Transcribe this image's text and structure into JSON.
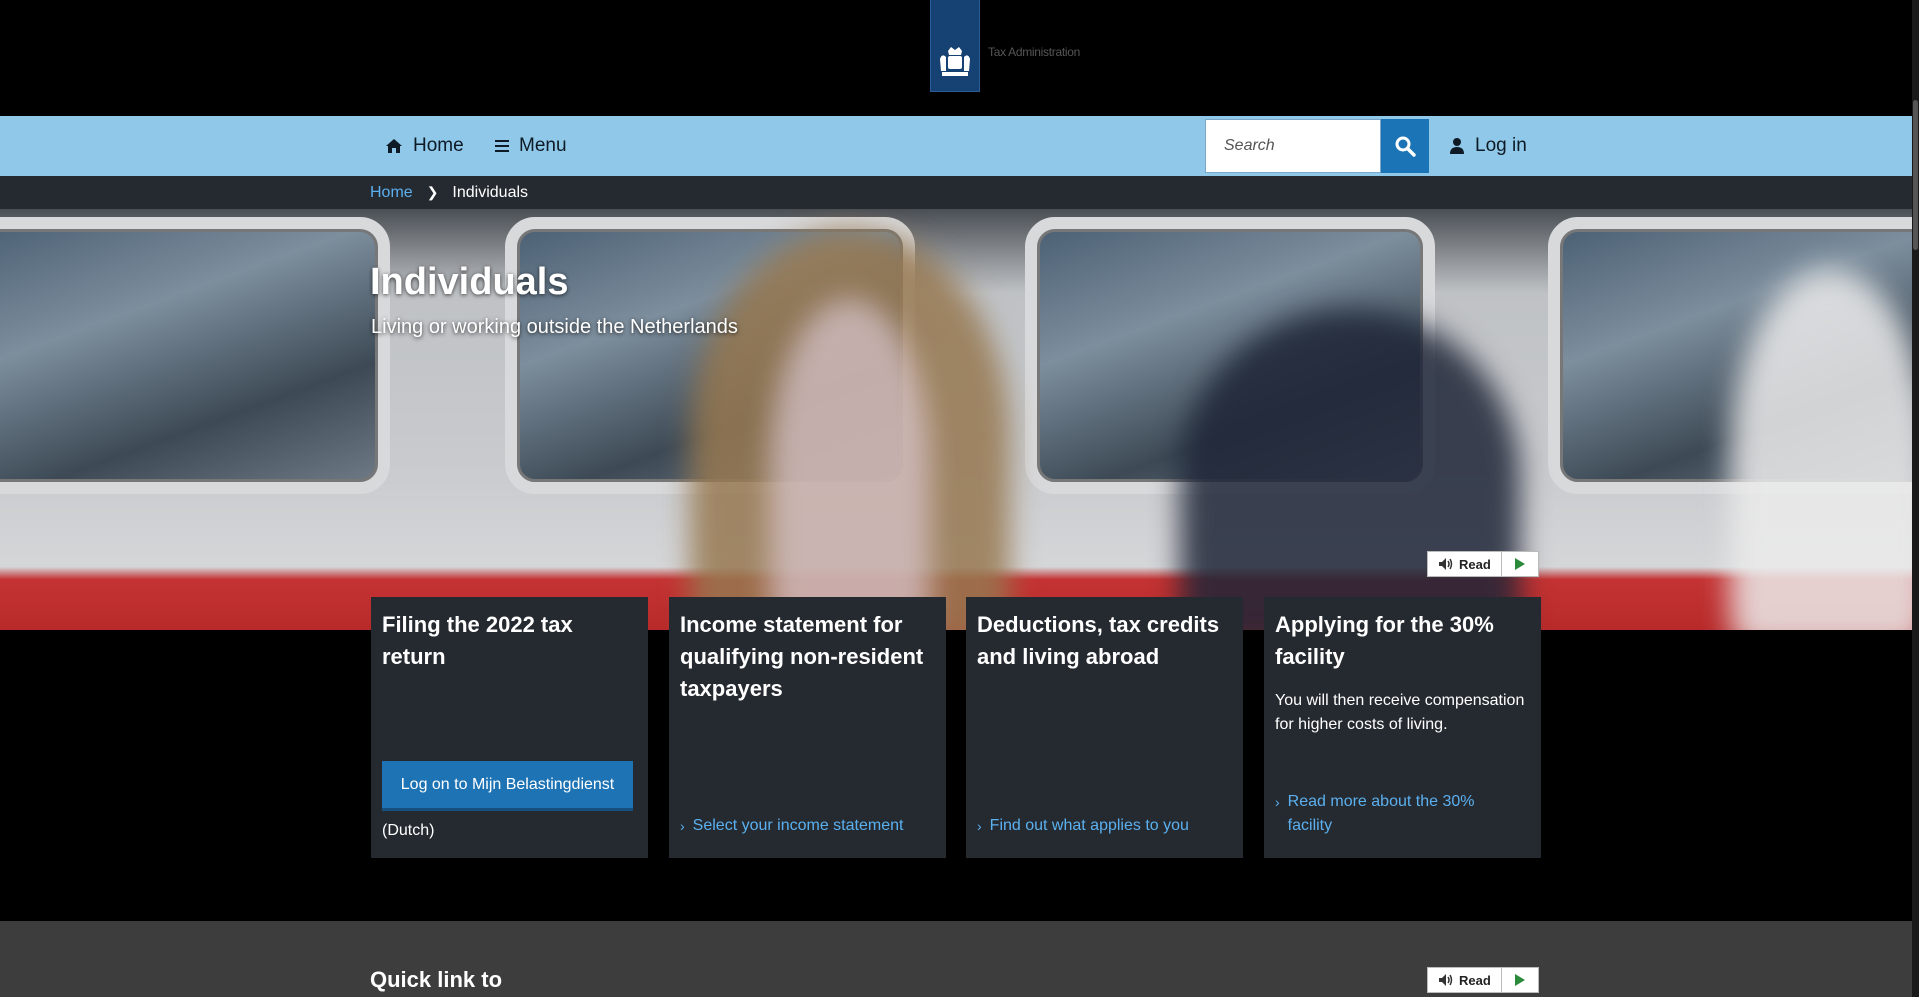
{
  "header": {
    "logo_text": "Tax Administration"
  },
  "nav": {
    "home_label": "Home",
    "menu_label": "Menu",
    "search_placeholder": "Search",
    "login_label": "Log in"
  },
  "breadcrumb": {
    "home": "Home",
    "current": "Individuals"
  },
  "hero": {
    "title": "Individuals",
    "subtitle": "Living or working outside the Netherlands",
    "read_label": "Read"
  },
  "cards": [
    {
      "title": "Filing the 2022 tax return",
      "button_label": "Log on to Mijn Belastingdienst",
      "note": "(Dutch)"
    },
    {
      "title": "Income statement for qualifying non-resident taxpayers",
      "link": "Select your income statement"
    },
    {
      "title": "Deductions, tax credits and living abroad",
      "link": "Find out what applies to you"
    },
    {
      "title": "Applying for the 30% facility",
      "text": "You will then receive compensation for higher costs of living.",
      "link": "Read more about the 30% facility"
    }
  ],
  "quick_links": {
    "title": "Quick link to",
    "read_label": "Read"
  },
  "colors": {
    "nav_bg": "#8fc8e8",
    "accent": "#1e73b4",
    "card_bg": "#252a30",
    "link": "#5bb0f0"
  }
}
